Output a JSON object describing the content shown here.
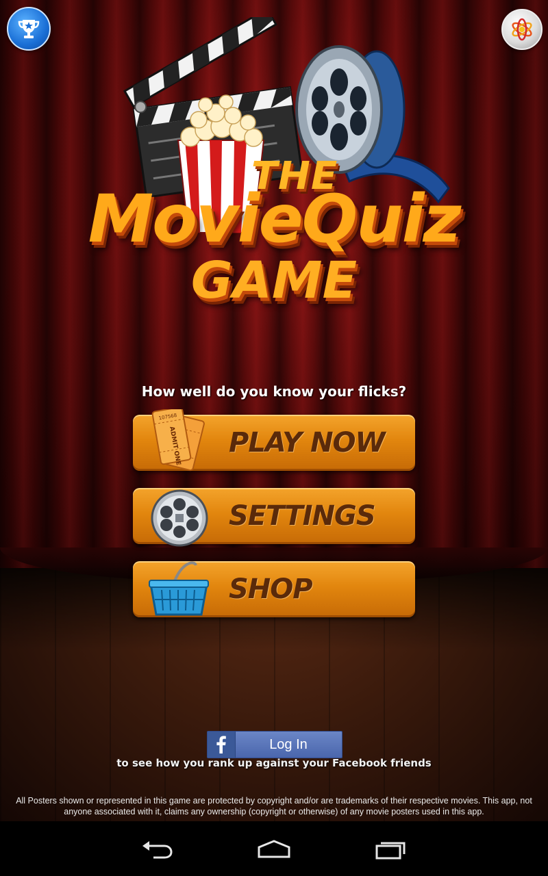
{
  "logo": {
    "line1": "THE",
    "line2": "MovieQuiz",
    "line3": "GAME"
  },
  "header": {
    "left_icon": "trophy-icon",
    "right_icon": "atom-app-icon"
  },
  "tagline": "How well do you know your flicks?",
  "menu": {
    "play_label": "PLAY NOW",
    "settings_label": "SETTINGS",
    "shop_label": "SHOP",
    "ticket_text": "ADMIT ONE",
    "ticket_number": "107568"
  },
  "facebook": {
    "button_label": "Log In",
    "caption": "to see how you rank up against your Facebook friends"
  },
  "disclaimer": "All Posters shown or represented in this game are protected by copyright and/or are trademarks of their respective movies. This app, not anyone associated with it, claims any ownership (copyright or otherwise) of any movie posters used in this app.",
  "navbar": {
    "back_icon": "back-icon",
    "home_icon": "home-icon",
    "recents_icon": "recents-icon"
  },
  "colors": {
    "curtain": "#6b0c0c",
    "button_orange": "#e2860e",
    "button_text": "#5a2a0a",
    "logo_orange": "#ffa91a",
    "facebook_blue": "#4a66ad"
  }
}
